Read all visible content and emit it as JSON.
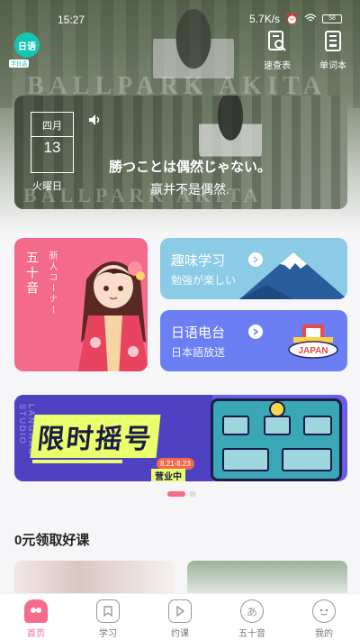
{
  "status_bar": {
    "time": "15:27",
    "net_speed": "5.7K/s",
    "battery": "58"
  },
  "header": {
    "logo_text": "日语",
    "logo_sub": "学日语",
    "actions": [
      {
        "label": "速查表",
        "icon": "search-doc-icon"
      },
      {
        "label": "单词本",
        "icon": "wordbook-icon"
      }
    ]
  },
  "background_watermark": "BALLPARK AKITA",
  "daily_sentence": {
    "month": "四月",
    "day": "13",
    "weekday": "火曜日",
    "japanese": "勝つことは偶然じゃない。",
    "chinese": "赢并不是偶然.",
    "watermark": "BALLPARK AKITA"
  },
  "features": {
    "gojuon": {
      "title": "五十音",
      "subtitle": "新人コーナー"
    },
    "fun": {
      "title": "趣味学习",
      "subtitle": "勉強が楽しい"
    },
    "radio": {
      "title": "日语电台",
      "subtitle": "日本語放送",
      "badge": "JAPAN"
    }
  },
  "banner": {
    "side_text": "LANGHAO STUDIO",
    "headline": "限时摇号",
    "dates": "8.21-8.23",
    "status": "营业中"
  },
  "carousel": {
    "count": 2,
    "active": 0
  },
  "section": {
    "title": "0元领取好课"
  },
  "tabbar": [
    {
      "label": "首页",
      "active": true,
      "icon": "home-icon"
    },
    {
      "label": "学习",
      "active": false,
      "icon": "bookmark-icon"
    },
    {
      "label": "约课",
      "active": false,
      "icon": "play-icon"
    },
    {
      "label": "五十音",
      "active": false,
      "icon": "kana-icon",
      "glyph": "あ"
    },
    {
      "label": "我的",
      "active": false,
      "icon": "profile-icon"
    }
  ],
  "colors": {
    "accent": "#f66a8c",
    "teal": "#12c6b1",
    "sky": "#8ccbe6",
    "indigo": "#6b7ff2"
  }
}
